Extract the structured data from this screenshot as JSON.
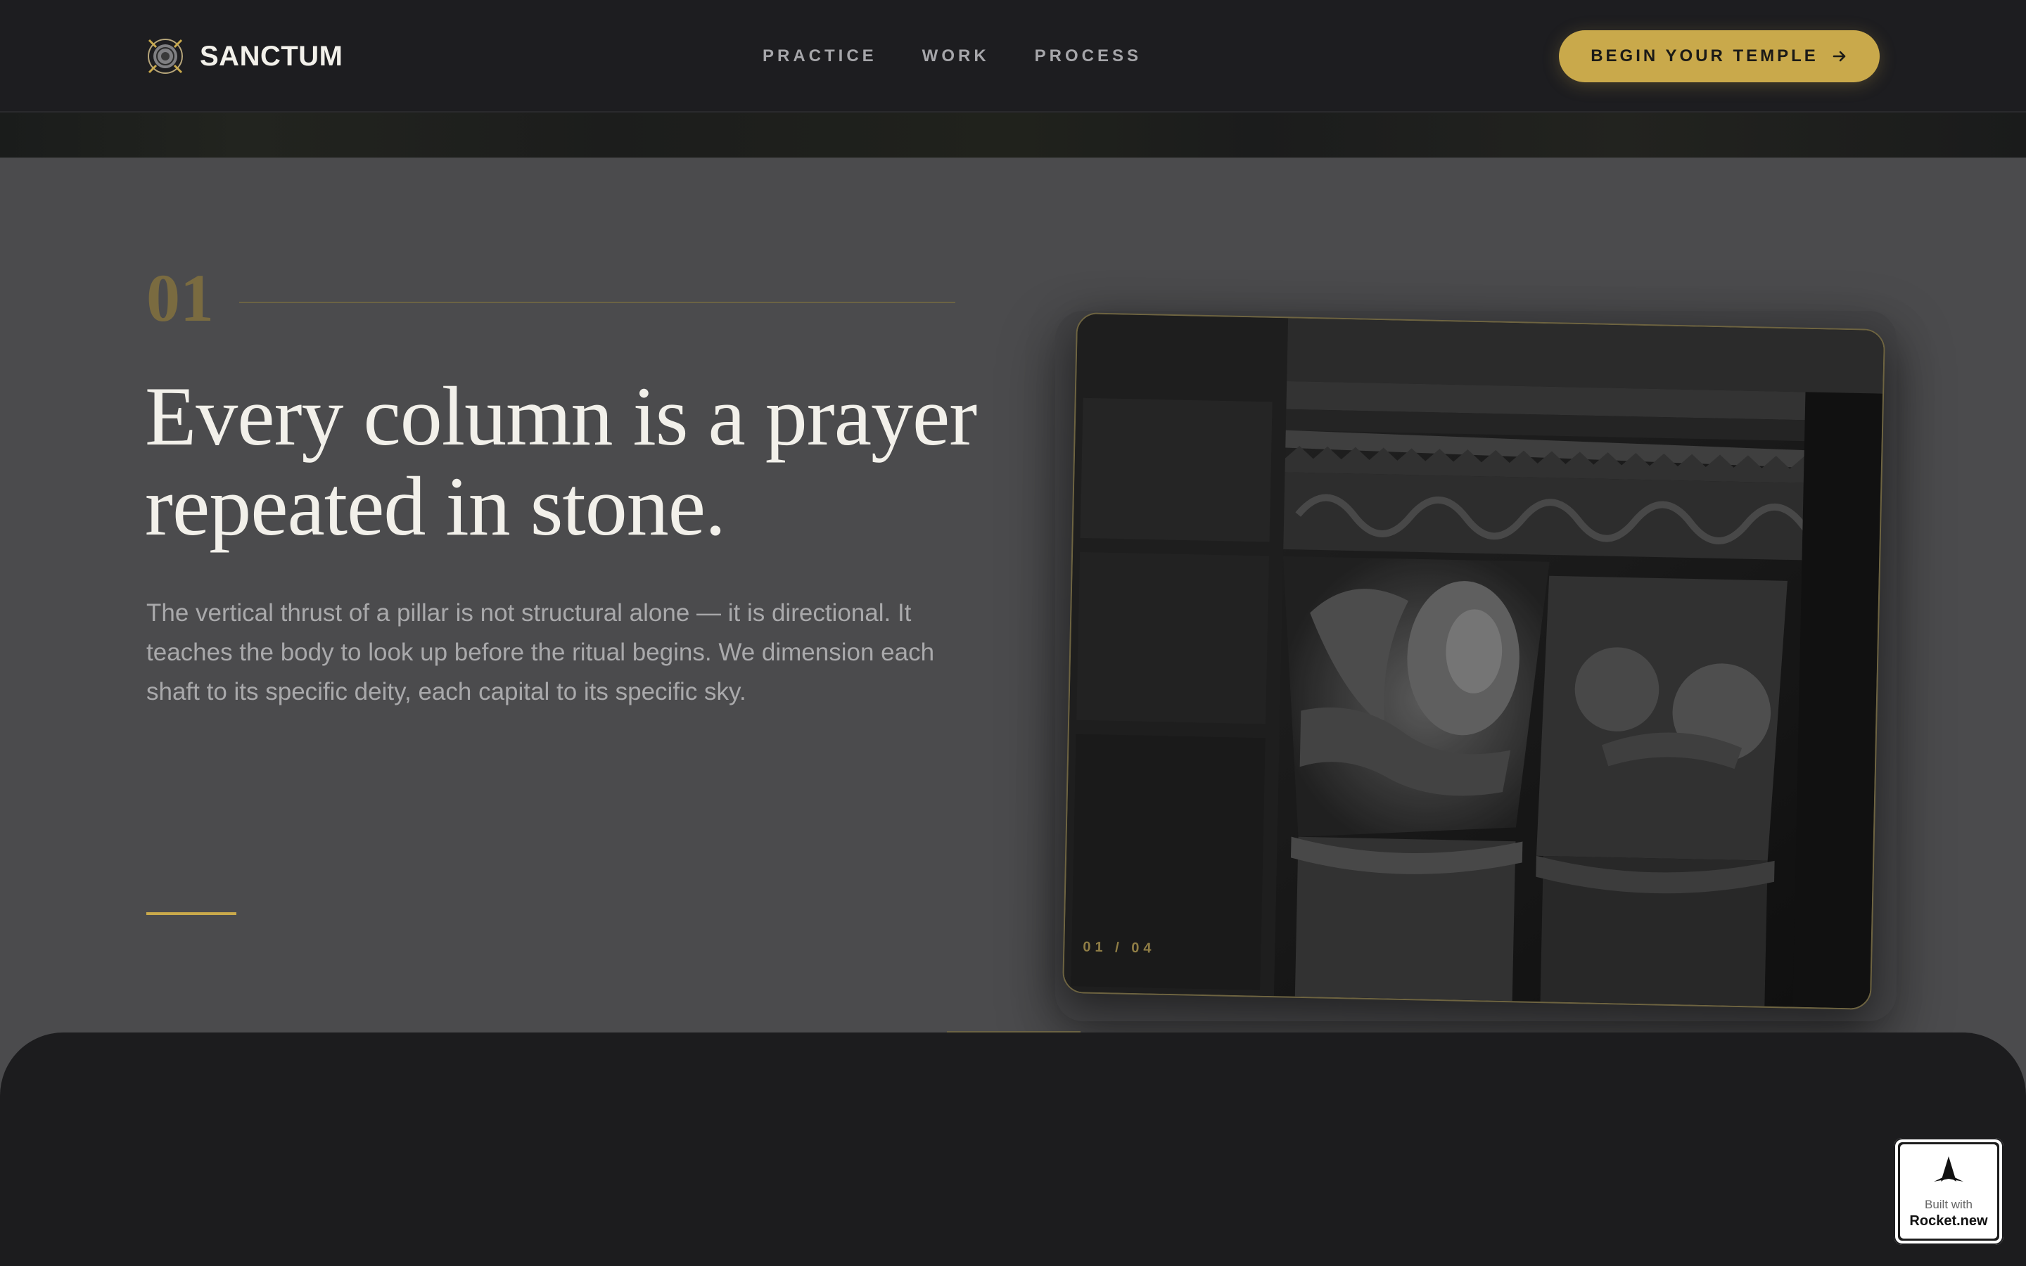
{
  "header": {
    "brand": "SANCTUM",
    "nav": [
      {
        "label": "PRACTICE"
      },
      {
        "label": "WORK"
      },
      {
        "label": "PROCESS"
      }
    ],
    "cta_label": "BEGIN YOUR TEMPLE",
    "cta_icon": "arrow-right-icon"
  },
  "section": {
    "number": "01",
    "headline_line1": "Every column is a prayer",
    "headline_line2": "repeated in stone.",
    "body": "The vertical thrust of a pillar is not structural alone — it is directional. It teaches the body to look up before the ritual begins. We dimension each shaft to its specific deity, each capital to its specific sky.",
    "image_counter": "01 / 04",
    "image_subject": "carved stone column capitals (black and white photo)"
  },
  "badge": {
    "small": "Built with",
    "big": "Rocket.new"
  },
  "colors": {
    "accent": "#c9a94b",
    "header_bg": "#1d1d20",
    "section_bg": "#4b4b4d",
    "text_light": "#f2f0ea",
    "text_muted": "#a9a9ab"
  }
}
